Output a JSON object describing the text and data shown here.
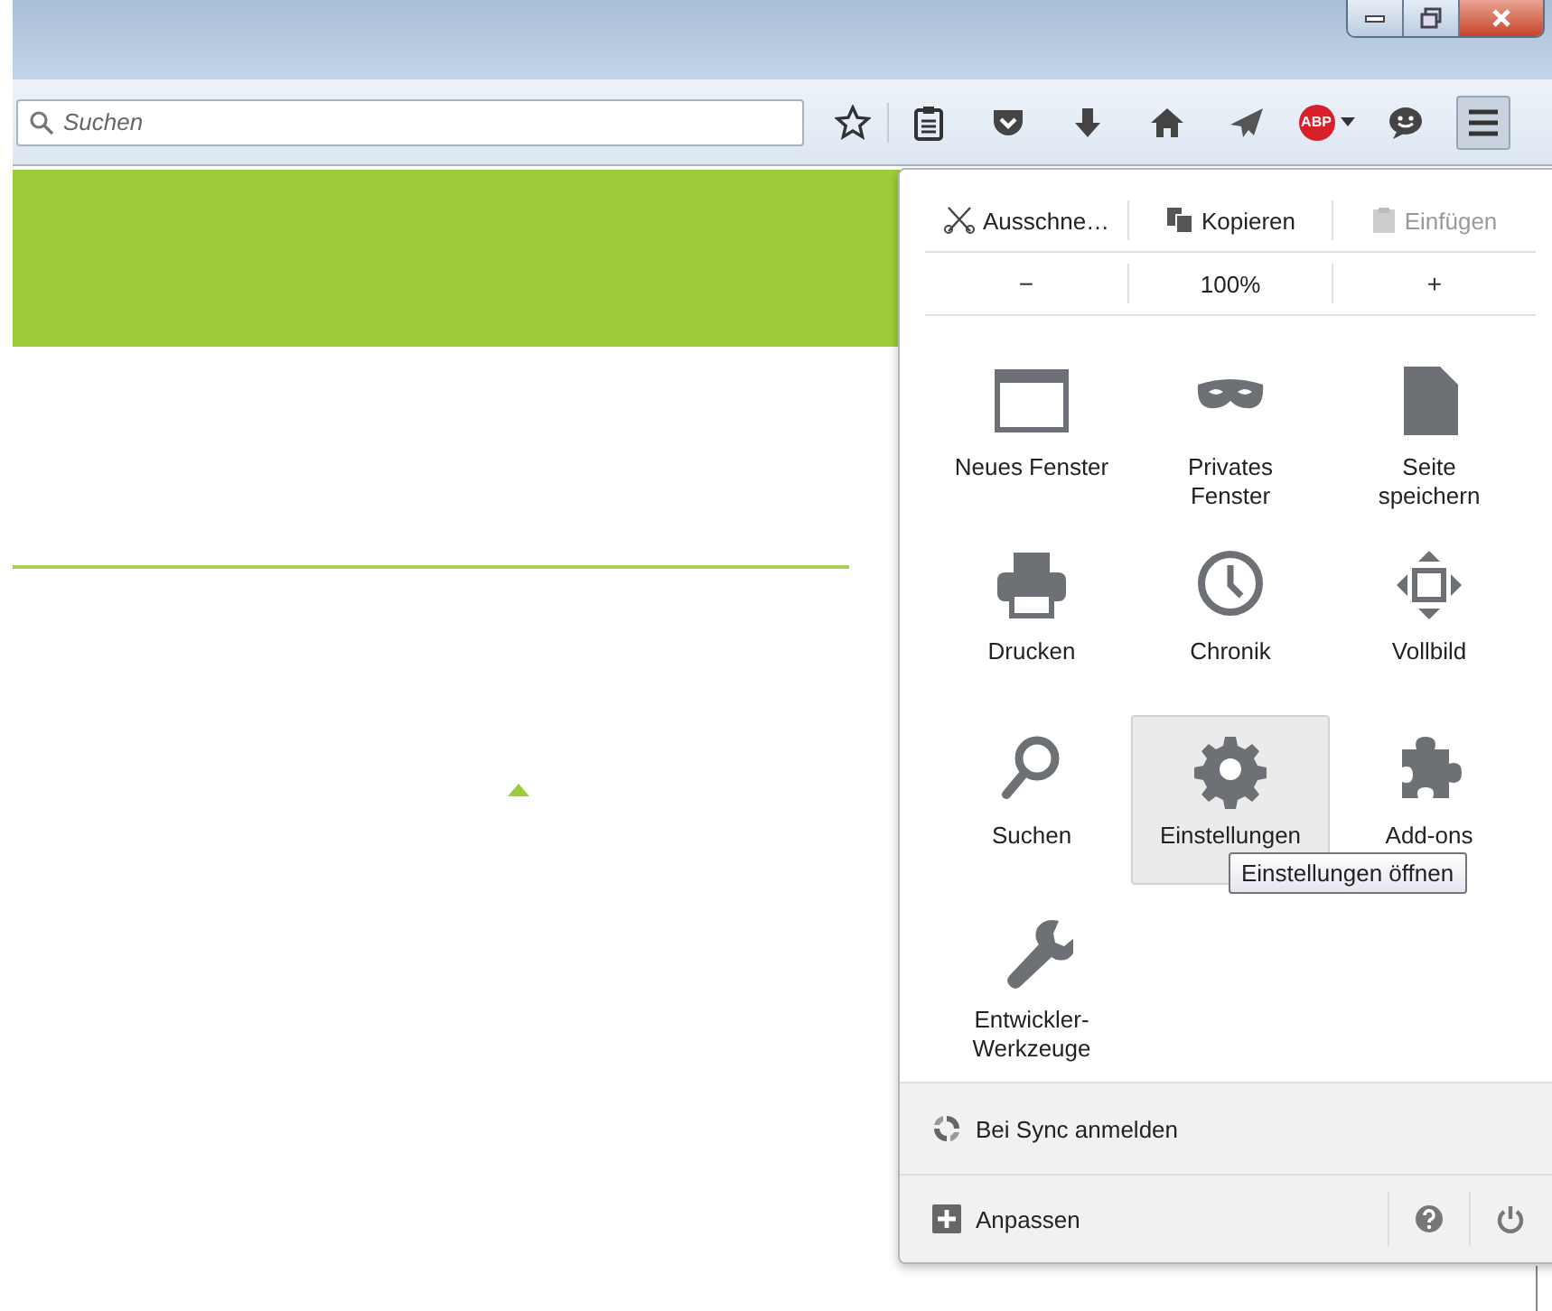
{
  "window": {
    "controls": [
      {
        "kind": "minimize"
      },
      {
        "kind": "maximize"
      },
      {
        "kind": "close"
      }
    ]
  },
  "toolbar": {
    "search": {
      "placeholder": "Suchen"
    },
    "buttons": [
      {
        "kind": "star"
      },
      {
        "kind": "reading-list"
      },
      {
        "kind": "pocket"
      },
      {
        "kind": "download"
      },
      {
        "kind": "home"
      },
      {
        "kind": "send"
      },
      {
        "kind": "abp",
        "label": "ABP"
      },
      {
        "kind": "chat"
      }
    ],
    "menu_button": {
      "pressed": true
    }
  },
  "menu": {
    "edit": [
      {
        "kind": "cut",
        "label": "Ausschne…",
        "disabled": false
      },
      {
        "kind": "copy",
        "label": "Kopieren",
        "disabled": false
      },
      {
        "kind": "paste",
        "label": "Einfügen",
        "disabled": true
      }
    ],
    "zoom": {
      "out": "−",
      "level": "100%",
      "in": "+"
    },
    "items": [
      {
        "kind": "window",
        "label": "Neues Fenster",
        "selected": false
      },
      {
        "kind": "mask",
        "label": "Privates\nFenster",
        "selected": false
      },
      {
        "kind": "page",
        "label": "Seite\nspeichern",
        "selected": false
      },
      {
        "kind": "printer",
        "label": "Drucken",
        "selected": false
      },
      {
        "kind": "clock",
        "label": "Chronik",
        "selected": false
      },
      {
        "kind": "fullscreen",
        "label": "Vollbild",
        "selected": false
      },
      {
        "kind": "search",
        "label": "Suchen",
        "selected": false
      },
      {
        "kind": "gear",
        "label": "Einstellungen",
        "selected": true
      },
      {
        "kind": "puzzle",
        "label": "Add-ons",
        "selected": false
      },
      {
        "kind": "wrench",
        "label": "Entwickler-\nWerkzeuge",
        "selected": false
      }
    ],
    "tooltip": "Einstellungen öffnen",
    "sync": "Bei Sync anmelden",
    "customize": "Anpassen",
    "footer_buttons": [
      {
        "kind": "help"
      },
      {
        "kind": "power"
      }
    ]
  }
}
